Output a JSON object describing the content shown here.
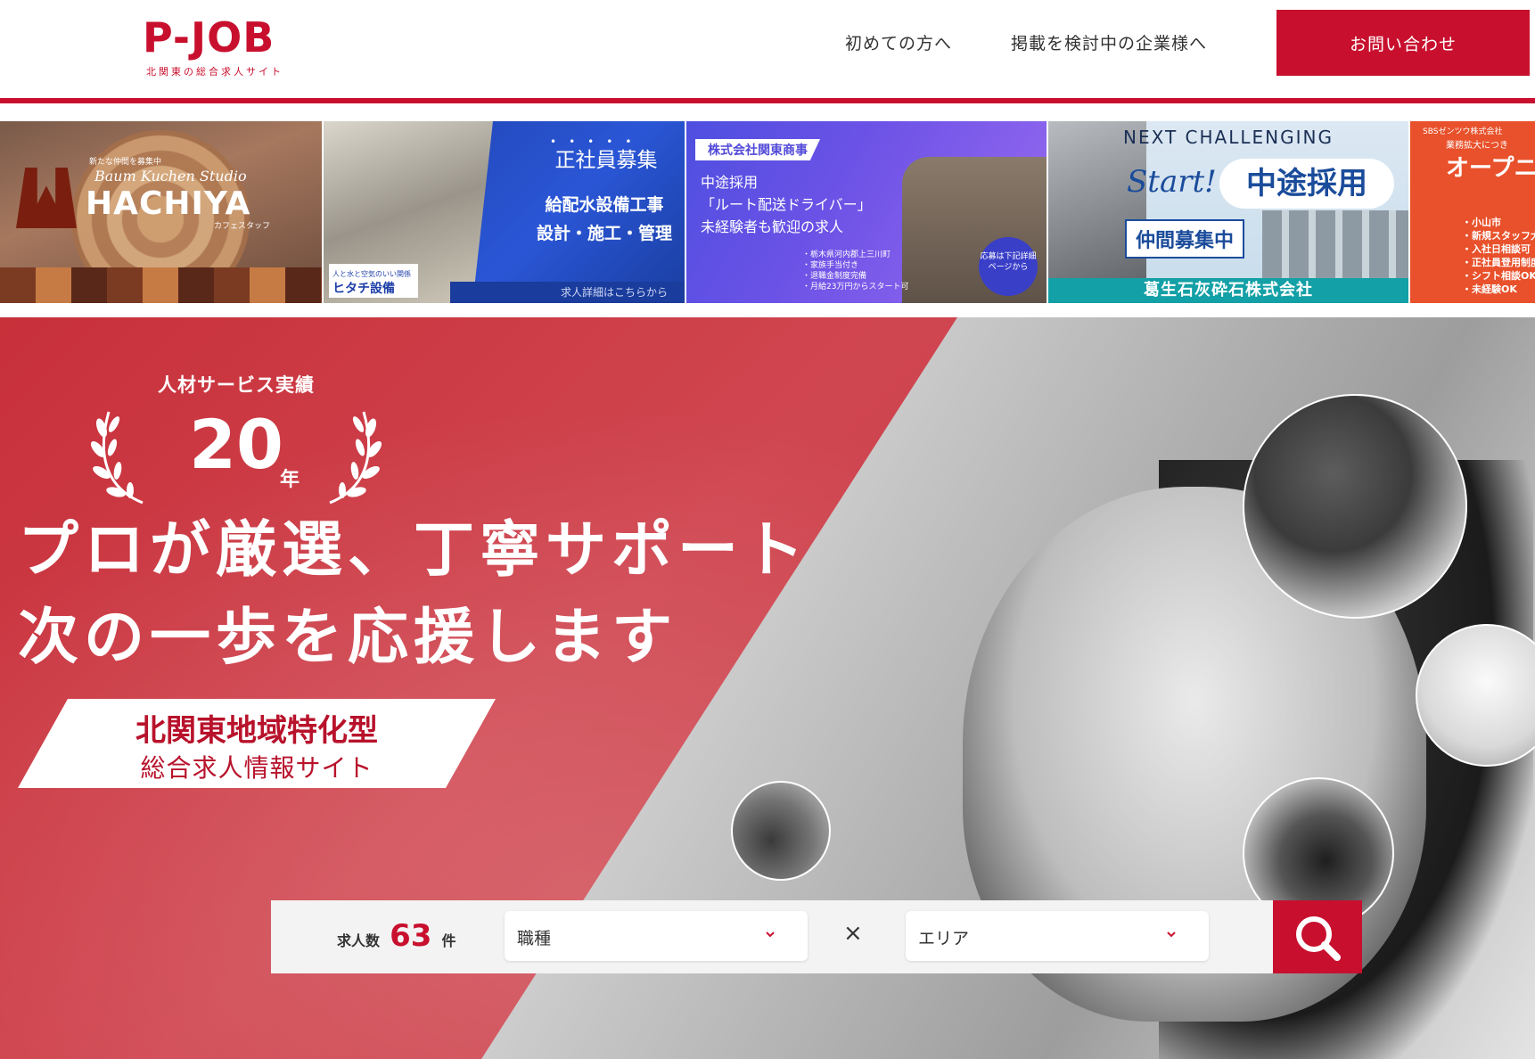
{
  "header": {
    "logo": "P-JOB",
    "tagline": "北関東の総合求人サイト",
    "nav": [
      "初めての方へ",
      "掲載を検討中の企業様へ"
    ],
    "contact_label": "お問い合わせ"
  },
  "banners": {
    "hachiya": {
      "tag": "新たな仲間を募集中",
      "script": "Baum Kuchen Studio",
      "brand": "HACHIYA",
      "note": "カフェスタッフ"
    },
    "hitachi": {
      "title": "正社員募集",
      "job_line1": "給配水設備工事",
      "job_line2": "設計・施工・管理",
      "company_tag": "人と水と空気のいい関係",
      "company_name": "ヒタチ設備",
      "more": "求人詳細はこちらから"
    },
    "kanto": {
      "company": "株式会社関東商事",
      "line1": "中途採用",
      "line2": "「ルート配送ドライバー」",
      "line3": "未経験者も歓迎の求人",
      "bullets": [
        "・栃木県河内郡上三川町",
        "・家族手当付き",
        "・退職金制度完備",
        "・月給23万円からスタート可"
      ],
      "badge": "応募は下記詳細ページから"
    },
    "kuzuu": {
      "headline": "NEXT CHALLENGING",
      "start": "Start!",
      "recruit": "中途採用",
      "nakama": "仲間募集中",
      "company": "葛生石灰砕石株式会社"
    },
    "sbs": {
      "corp": "SBSゼンツウ株式会社",
      "sub": "業務拡大につき",
      "open": "オープニ",
      "list": [
        "・小山市",
        "・新規スタッフ大",
        "・入社日相談可",
        "・正社員登用制度",
        "・シフト相談OK",
        "・未経験OK"
      ]
    }
  },
  "hero": {
    "achievement_label": "人材サービス実績",
    "years": "20",
    "years_unit": "年",
    "catch_line1": "プロが厳選、丁寧サポート",
    "catch_line2": "次の一歩を応援します",
    "region_line1": "北関東地域特化型",
    "region_line2": "総合求人情報サイト"
  },
  "search": {
    "count_prefix": "求人数",
    "count": "63",
    "count_suffix": "件",
    "job_type": "職種",
    "area": "エリア",
    "times": "×"
  },
  "colors": {
    "brand_red": "#c8102e",
    "hero_red": "#c8303a",
    "search_bg": "#f3f3f3"
  },
  "icons": {
    "search_button": "magnifier-icon",
    "select_chevron": "chevron-down-icon",
    "laurel": "laurel-wreath-icon"
  }
}
